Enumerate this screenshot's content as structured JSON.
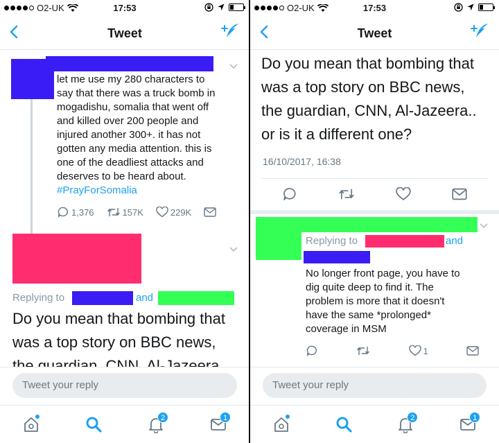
{
  "status_bar": {
    "carrier": "O2-UK",
    "time": "17:53"
  },
  "nav": {
    "title": "Tweet"
  },
  "left": {
    "tweet_lines": [
      "let me use my 280 characters to",
      "say that there was a truck bomb in",
      "mogadishu, somalia that went off",
      "and killed over 200 people and",
      "injured another 300+. it has not",
      "gotten any media attention. this is",
      "one of the deadliest attacks and",
      "deserves to be heard about."
    ],
    "hashtag": "#PrayForSomalia",
    "replies_count": "1,376",
    "retweets_count": "157K",
    "likes_count": "229K",
    "replying_to": "Replying to",
    "and": "and",
    "reply_lines": [
      "Do you mean that bombing that",
      "was a top story on BBC news,",
      "the guardian, CNN,  Al-Jazeera.."
    ]
  },
  "right": {
    "main_lines": [
      "Do you mean that bombing that",
      "was a top story on BBC news,",
      "the guardian, CNN,  Al-Jazeera..",
      "or is it a different one?"
    ],
    "date": "16/10/2017, 16:38",
    "replying_to": "Replying to",
    "and": "and",
    "reply_lines": [
      "No longer front page, you have to",
      "dig quite deep to find it. The",
      "problem is more that it doesn't",
      "have the same *prolonged*",
      "coverage in MSM"
    ],
    "reply_likes": "1"
  },
  "reply_placeholder": "Tweet your reply",
  "tabs": {
    "notifications_badge": "2",
    "messages_badge": "1"
  },
  "colors": {
    "accent": "#1da1f2",
    "redact_blue": "#3a1cf5",
    "redact_pink": "#ff2d6f",
    "redact_green": "#33ff55"
  }
}
